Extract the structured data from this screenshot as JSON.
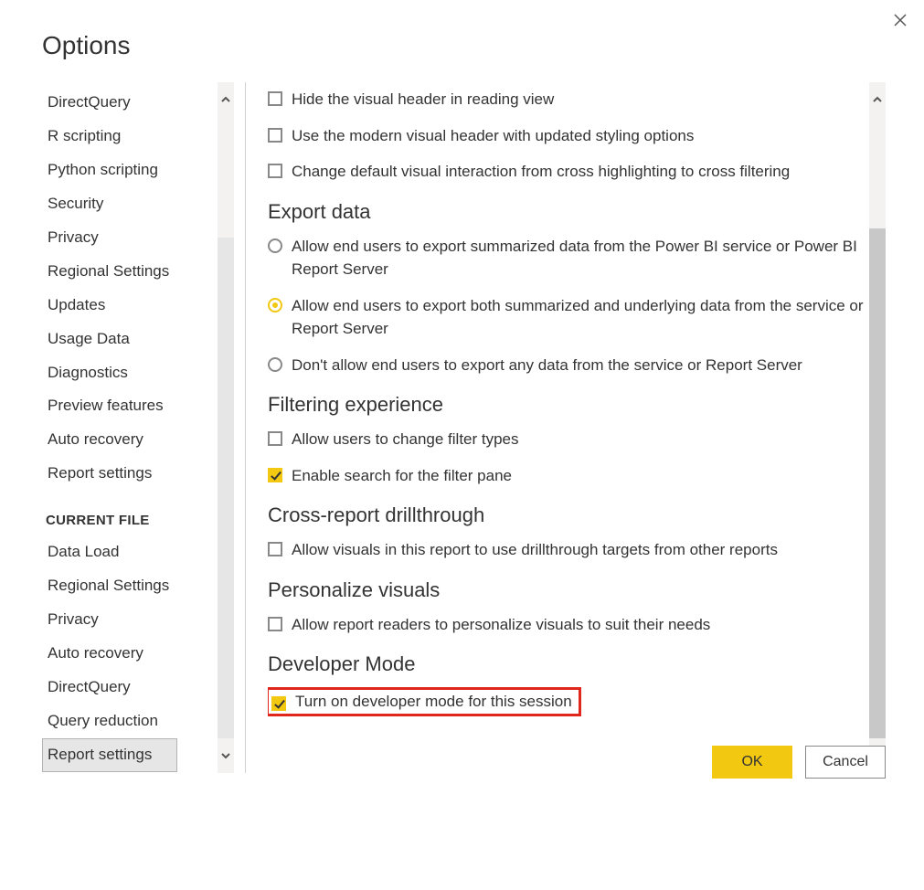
{
  "dialog": {
    "title": "Options"
  },
  "colors": {
    "accent": "#f2c811",
    "highlight": "#e1261c"
  },
  "sidebar": {
    "global_items": [
      "DirectQuery",
      "R scripting",
      "Python scripting",
      "Security",
      "Privacy",
      "Regional Settings",
      "Updates",
      "Usage Data",
      "Diagnostics",
      "Preview features",
      "Auto recovery",
      "Report settings"
    ],
    "current_file_heading": "CURRENT FILE",
    "current_file_items": [
      "Data Load",
      "Regional Settings",
      "Privacy",
      "Auto recovery",
      "DirectQuery",
      "Query reduction",
      "Report settings"
    ],
    "selected": "Report settings"
  },
  "settings": {
    "visual_options": [
      {
        "label": "Hide the visual header in reading view",
        "checked": false
      },
      {
        "label": "Use the modern visual header with updated styling options",
        "checked": false
      },
      {
        "label": "Change default visual interaction from cross highlighting to cross filtering",
        "checked": false
      }
    ],
    "export": {
      "heading": "Export data",
      "options": [
        "Allow end users to export summarized data from the Power BI service or Power BI Report Server",
        "Allow end users to export both summarized and underlying data from the service or Report Server",
        "Don't allow end users to export any data from the service or Report Server"
      ],
      "selected_index": 1
    },
    "filtering": {
      "heading": "Filtering experience",
      "options": [
        {
          "label": "Allow users to change filter types",
          "checked": false
        },
        {
          "label": "Enable search for the filter pane",
          "checked": true
        }
      ]
    },
    "crossreport": {
      "heading": "Cross-report drillthrough",
      "option": {
        "label": "Allow visuals in this report to use drillthrough targets from other reports",
        "checked": false
      }
    },
    "personalize": {
      "heading": "Personalize visuals",
      "option": {
        "label": "Allow report readers to personalize visuals to suit their needs",
        "checked": false
      }
    },
    "developer": {
      "heading": "Developer Mode",
      "option": {
        "label": "Turn on developer mode for this session",
        "checked": true
      }
    }
  },
  "buttons": {
    "ok": "OK",
    "cancel": "Cancel"
  }
}
